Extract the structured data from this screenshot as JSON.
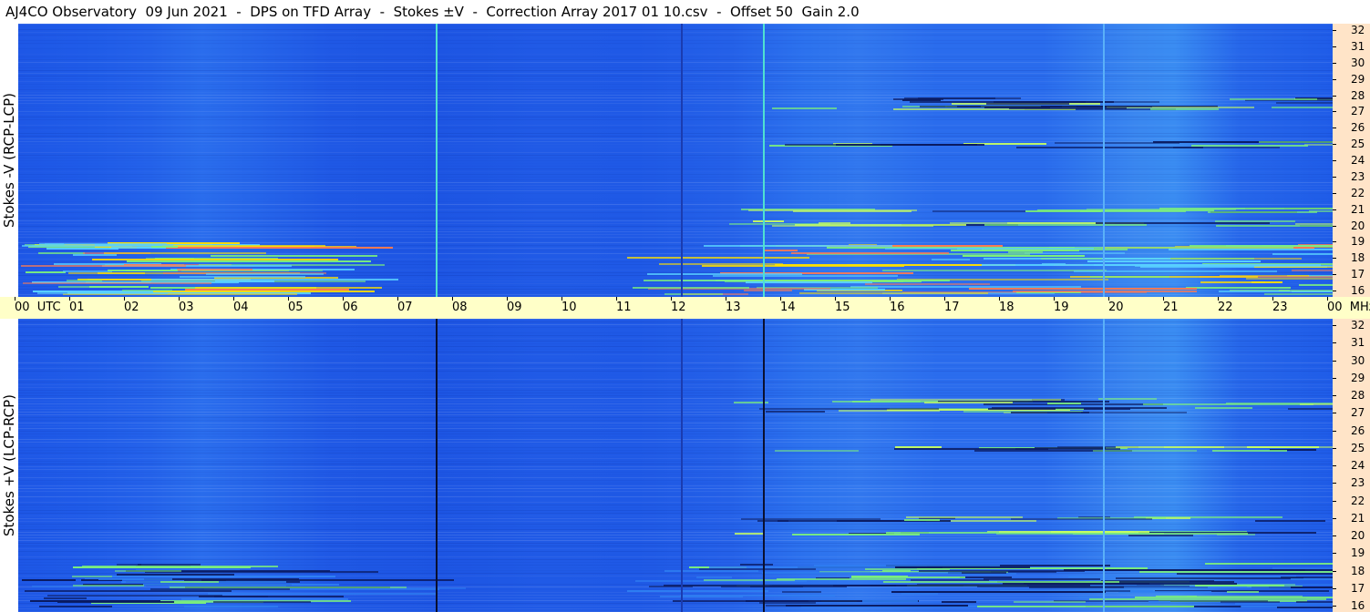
{
  "title": "AJ4CO Observatory  09 Jun 2021  -  DPS on TFD Array  -  Stokes ±V  -  Correction Array 2017 01 10.csv  -  Offset 50  Gain 2.0",
  "top_panel": {
    "label": "Stokes -V (RCP-LCP)"
  },
  "bottom_panel": {
    "label": "Stokes +V (LCP-RCP)"
  },
  "x_axis": {
    "labels": [
      "00  UTC",
      "01",
      "02",
      "03",
      "04",
      "05",
      "06",
      "07",
      "08",
      "09",
      "10",
      "11",
      "12",
      "13",
      "14",
      "15",
      "16",
      "17",
      "18",
      "19",
      "20",
      "21",
      "22",
      "23",
      "00  MHz"
    ]
  },
  "y_axis": {
    "labels": [
      "32",
      "31",
      "30",
      "29",
      "28",
      "27",
      "26",
      "25",
      "24",
      "23",
      "22",
      "21",
      "20",
      "19",
      "18",
      "17",
      "16"
    ],
    "unit": "MHz"
  },
  "colors": {
    "background_low": "#1e57e6",
    "background_high": "#3a8cf2",
    "hot": "#ffe000",
    "warm": "#7cf07c",
    "cold": "#0a1a60",
    "axis_x_bg": "#ffffc8",
    "axis_y_bg": "#ffe4c8"
  }
}
